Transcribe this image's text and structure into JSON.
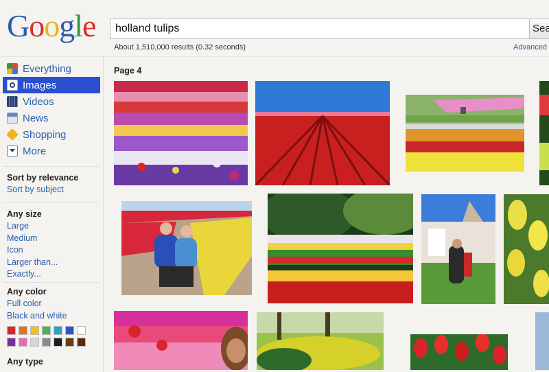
{
  "logo": {
    "letters": [
      "G",
      "o",
      "o",
      "g",
      "l",
      "e"
    ]
  },
  "search": {
    "query": "holland tulips",
    "button_label": "Sea"
  },
  "results": {
    "stats": "About 1,510,000 results (0.32 seconds)",
    "advanced_label": "Advanced"
  },
  "sidebar": {
    "nav": [
      {
        "label": "Everything",
        "icon": "everything-icon",
        "color": "#e8492e"
      },
      {
        "label": "Images",
        "icon": "images-icon",
        "color": "#9fd37a"
      },
      {
        "label": "Videos",
        "icon": "videos-icon",
        "color": "#2b3f6c"
      },
      {
        "label": "News",
        "icon": "news-icon",
        "color": "#6c87b8"
      },
      {
        "label": "Shopping",
        "icon": "shopping-icon",
        "color": "#f2b51f"
      },
      {
        "label": "More",
        "icon": "more-icon",
        "color": "#5d7fbf"
      }
    ],
    "sort": {
      "heading": "Sort by relevance",
      "link": "Sort by subject"
    },
    "size": {
      "heading": "Any size",
      "options": [
        "Large",
        "Medium",
        "Icon",
        "Larger than...",
        "Exactly..."
      ]
    },
    "color": {
      "heading": "Any color",
      "options": [
        "Full color",
        "Black and white"
      ],
      "swatches": [
        "#d8242a",
        "#e8731e",
        "#f0c419",
        "#4bb54a",
        "#22a9c7",
        "#2f52c8",
        "#ffffff",
        "#7a2d9c",
        "#e86ab6",
        "#d8d8d8",
        "#8b8b8b",
        "#1e1e1e",
        "#6b3a12",
        "#5a2a10"
      ]
    },
    "type": {
      "heading": "Any type"
    }
  },
  "main": {
    "page_label": "Page 4"
  }
}
